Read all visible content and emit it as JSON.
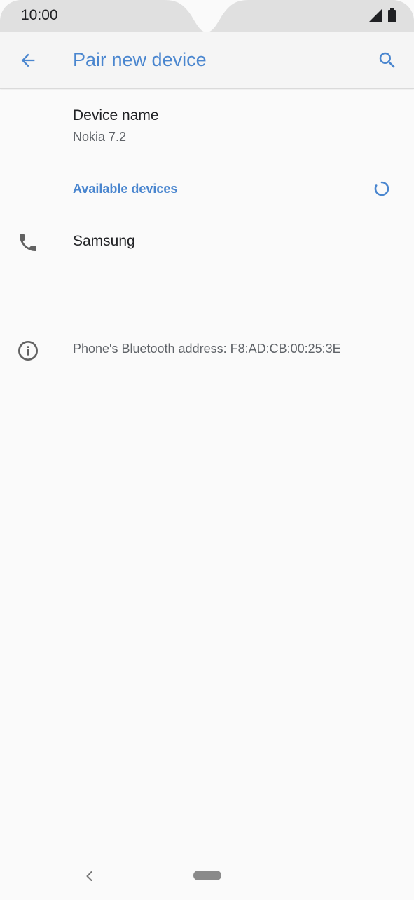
{
  "status_bar": {
    "time": "10:00",
    "icons": [
      "signal-icon",
      "battery-icon"
    ]
  },
  "app_bar": {
    "title": "Pair new device",
    "back_icon": "arrow-back-icon",
    "search_icon": "search-icon"
  },
  "device_name": {
    "title": "Device name",
    "value": "Nokia 7.2"
  },
  "available": {
    "header": "Available devices",
    "spinner_icon": "loading-spinner-icon",
    "devices": [
      {
        "label": "Samsung",
        "icon": "phone-icon"
      }
    ]
  },
  "info": {
    "icon": "info-icon",
    "text": "Phone's Bluetooth address: F8:AD:CB:00:25:3E"
  },
  "nav_bar": {
    "back_icon": "nav-back-icon",
    "home_icon": "home-pill-icon"
  },
  "colors": {
    "accent": "#4a86cf",
    "background": "#fafafa",
    "status_bar": "#e0e0e0",
    "text_primary": "#202124",
    "text_secondary": "#5f6368"
  }
}
